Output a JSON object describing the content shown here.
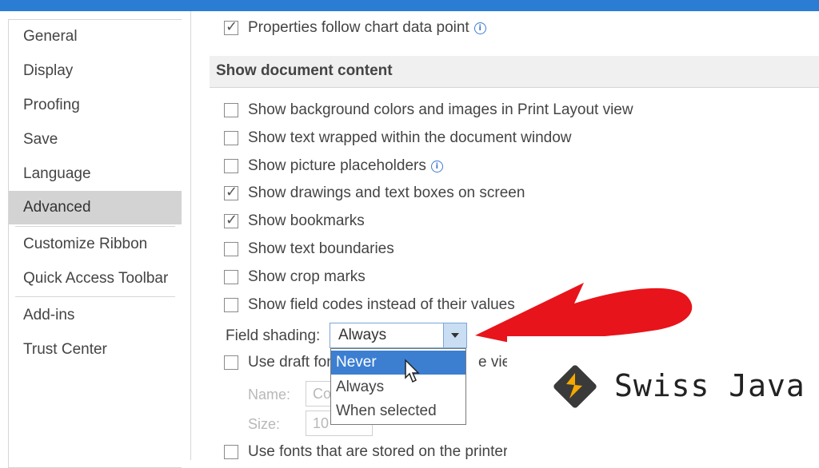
{
  "sidebar": {
    "items": [
      {
        "label": "General"
      },
      {
        "label": "Display"
      },
      {
        "label": "Proofing"
      },
      {
        "label": "Save"
      },
      {
        "label": "Language"
      },
      {
        "label": "Advanced",
        "selected": true
      },
      {
        "label": "Customize Ribbon"
      },
      {
        "label": "Quick Access Toolbar"
      },
      {
        "label": "Add-ins"
      },
      {
        "label": "Trust Center"
      }
    ]
  },
  "options": {
    "properties_follow": {
      "label": "Properties follow chart data point",
      "checked": true
    },
    "section_title": "Show document content",
    "checkboxes": [
      {
        "label": "Show background colors and images in Print Layout view",
        "checked": false
      },
      {
        "label": "Show text wrapped within the document window",
        "checked": false
      },
      {
        "label": "Show picture placeholders",
        "checked": false
      },
      {
        "label": "Show drawings and text boxes on screen",
        "checked": true
      },
      {
        "label": "Show bookmarks",
        "checked": true
      },
      {
        "label": "Show text boundaries",
        "checked": false
      },
      {
        "label": "Show crop marks",
        "checked": false
      },
      {
        "label": "Show field codes instead of their values",
        "checked": false
      }
    ],
    "field_shading": {
      "label": "Field shading:",
      "value": "Always",
      "options": [
        "Never",
        "Always",
        "When selected"
      ],
      "highlighted": "Never"
    },
    "draft_font": {
      "label_left": "Use draft fon",
      "label_right": "e view",
      "checked": false
    },
    "name_label": "Name:",
    "name_value": "Co",
    "size_label": "Size:",
    "size_value": "10",
    "printer_fonts": {
      "label": "Use fonts that are stored on the printer",
      "checked": false
    }
  },
  "logo": {
    "text": "Swiss Java"
  },
  "colors": {
    "accent": "#2b7cd3",
    "arrow": "#e8141b",
    "logo_orange": "#f5a800",
    "selection": "#3c7fd1"
  }
}
